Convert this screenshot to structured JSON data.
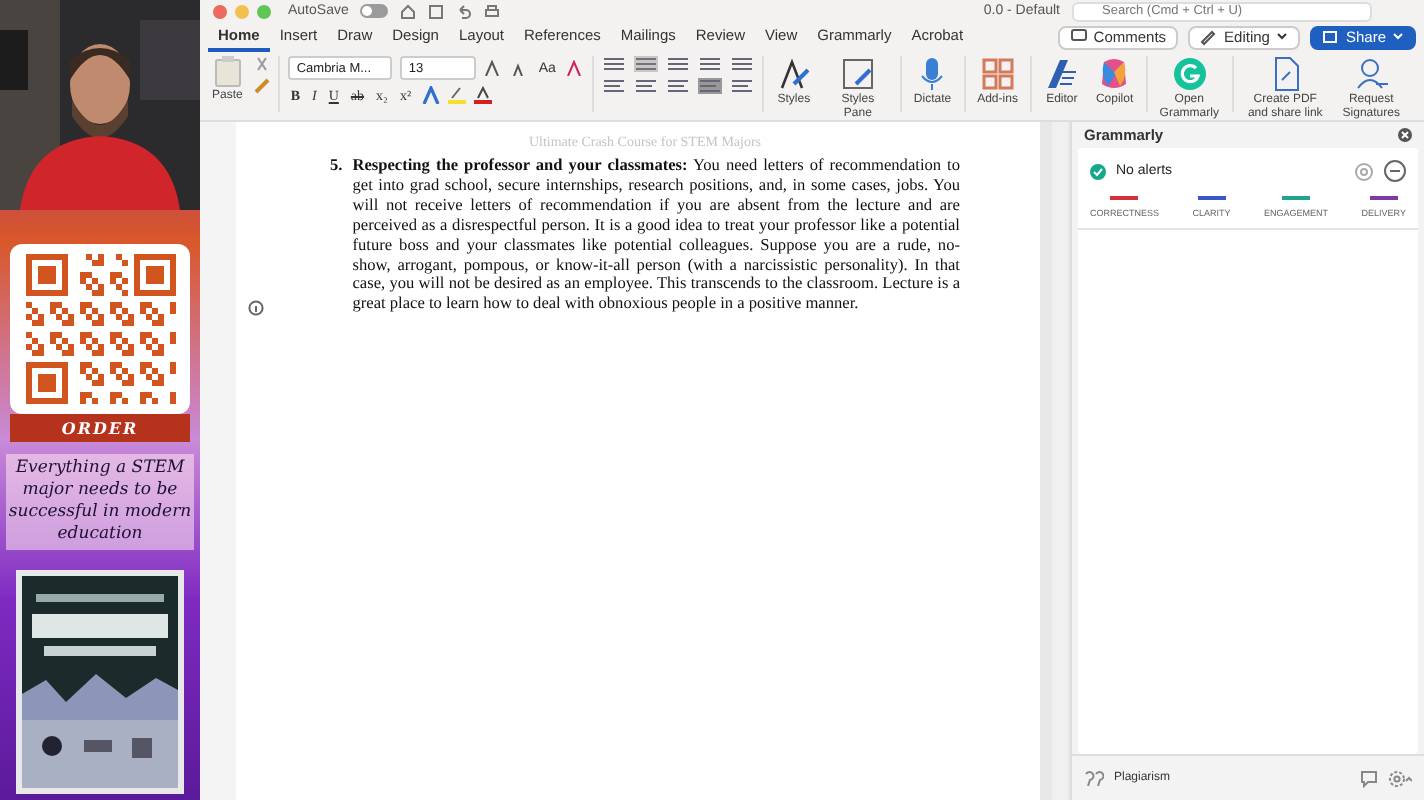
{
  "overlay": {
    "order_label": "ORDER",
    "tagline": "Everything a STEM major needs to be successful in modern education"
  },
  "title_bar": {
    "autosave_label": "AutoSave",
    "autosave_on": false,
    "document_title": "0.0 - Default",
    "search": {
      "placeholder": "Search (Cmd + Ctrl + U)"
    }
  },
  "tabs": [
    {
      "label": "Home",
      "selected": true
    },
    {
      "label": "Insert",
      "selected": false
    },
    {
      "label": "Draw",
      "selected": false
    },
    {
      "label": "Design",
      "selected": false
    },
    {
      "label": "Layout",
      "selected": false
    },
    {
      "label": "References",
      "selected": false
    },
    {
      "label": "Mailings",
      "selected": false
    },
    {
      "label": "Review",
      "selected": false
    },
    {
      "label": "View",
      "selected": false
    },
    {
      "label": "Grammarly",
      "selected": false
    },
    {
      "label": "Acrobat",
      "selected": false
    }
  ],
  "header_buttons": [
    {
      "kind": "comments",
      "label": "Comments"
    },
    {
      "kind": "editing",
      "label": "Editing"
    },
    {
      "kind": "share",
      "label": "Share"
    }
  ],
  "ribbon": {
    "paste_label": "Paste",
    "font_name": "Cambria M...",
    "font_size": "13",
    "change_case": "Aa",
    "format_buttons": [
      "B",
      "I",
      "U",
      "ab",
      "x₂",
      "x²"
    ],
    "tools": [
      {
        "kind": "styles",
        "label": "Styles"
      },
      {
        "kind": "styles-pane",
        "label": "Styles Pane"
      },
      {
        "kind": "dictate",
        "label": "Dictate"
      },
      {
        "kind": "add-ins",
        "label": "Add-ins"
      },
      {
        "kind": "editor",
        "label": "Editor"
      },
      {
        "kind": "copilot",
        "label": "Copilot"
      },
      {
        "kind": "grammarly",
        "label": "Open Grammarly"
      },
      {
        "kind": "pdf",
        "label": "Create PDF and share link"
      },
      {
        "kind": "signatures",
        "label": "Request Signatures"
      }
    ]
  },
  "document": {
    "header": "Ultimate Crash Course for STEM Majors",
    "items": [
      {
        "number": "5.",
        "text": "**Respecting the professor and your classmates:** You need letters of recommendation to get into grad school, secure internships, research positions, and, in some cases, jobs. You will not receive letters of recommendation if you are absent from the lecture and are perceived as a disrespectful person. It is a good idea to treat your professor like a potential future boss and your classmates like potential colleagues. Suppose you are a rude, no-show, arrogant, pompous, or know-it-all person (with a narcissistic personality). In that case, you will not be desired as an employee. This transcends to the classroom. Lecture is a great place to learn how to deal with obnoxious people in a positive manner."
      }
    ]
  },
  "grammarly": {
    "title": "Grammarly",
    "status": "No alerts",
    "categories": [
      {
        "label": "CORRECTNESS",
        "color": "#d0313a"
      },
      {
        "label": "CLARITY",
        "color": "#3a56c4"
      },
      {
        "label": "ENGAGEMENT",
        "color": "#1fa58a"
      },
      {
        "label": "DELIVERY",
        "color": "#7b3aa8"
      }
    ],
    "footer": "Plagiarism"
  }
}
